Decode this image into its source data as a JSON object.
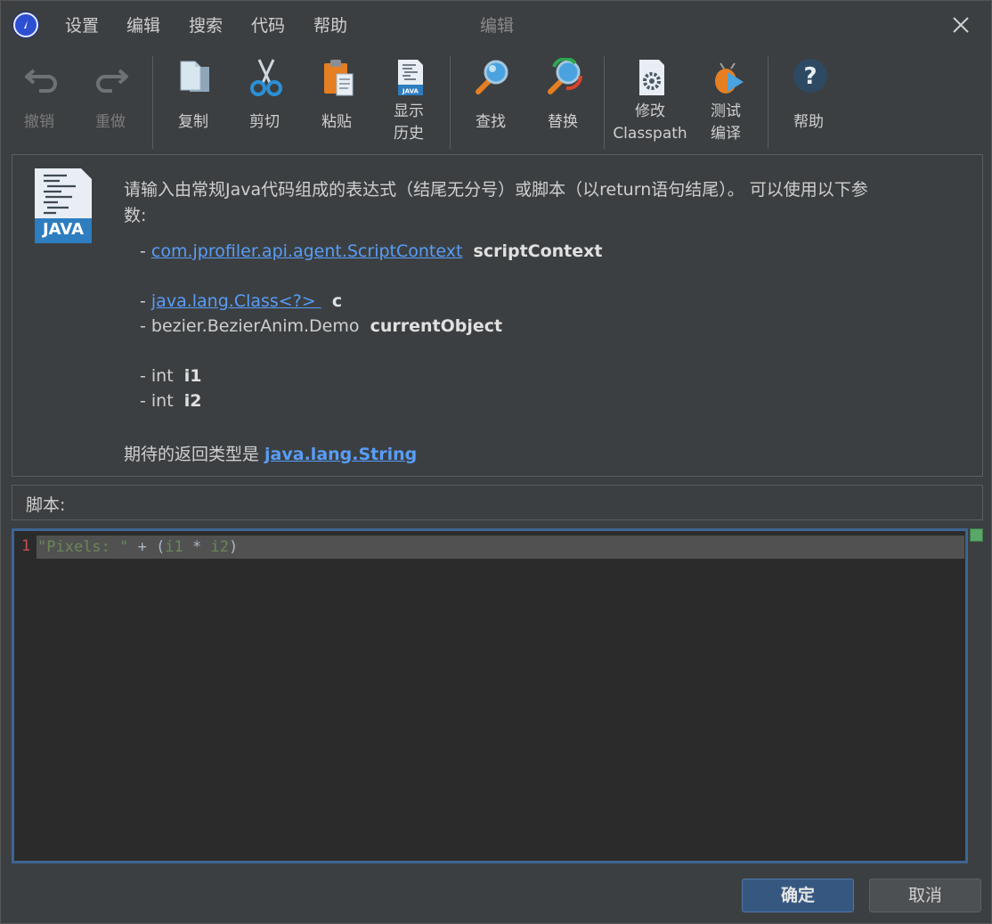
{
  "menu": {
    "items": [
      "设置",
      "编辑",
      "搜索",
      "代码",
      "帮助"
    ],
    "window_title": "编辑"
  },
  "toolbar": {
    "undo": "撤销",
    "redo": "重做",
    "copy": "复制",
    "cut": "剪切",
    "paste": "粘贴",
    "history_line1": "显示",
    "history_line2": "历史",
    "find": "查找",
    "replace": "替换",
    "classpath_line1": "修改",
    "classpath_line2": "Classpath",
    "compile_line1": "测试",
    "compile_line2": "编译",
    "help": "帮助"
  },
  "info": {
    "java_logo_text": "JAVA",
    "intro_line1": "请输入由常规Java代码组成的表达式（结尾无分号）或脚本（以return语句结尾）。 可以使用以下参",
    "intro_line2": "数:",
    "params": [
      {
        "prefix": "- ",
        "type": "com.jprofiler.api.agent.ScriptContext",
        "name": "scriptContext",
        "link": true
      },
      {
        "prefix": "- ",
        "type": "java.lang.Class<?> ",
        "name": "c",
        "link": true
      },
      {
        "prefix": "- ",
        "type": "bezier.BezierAnim.Demo",
        "name": "currentObject",
        "link": false
      },
      {
        "prefix": "- ",
        "type": "int",
        "name": "i1",
        "link": false
      },
      {
        "prefix": "- ",
        "type": "int",
        "name": "i2",
        "link": false
      }
    ],
    "return_prefix": "期待的返回类型是 ",
    "return_type": "java.lang.String"
  },
  "script": {
    "label": "脚本:",
    "line_number": "1",
    "code": {
      "string": "\"Pixels: \"",
      "plus": " + (",
      "var1": "i1",
      "times": " * ",
      "var2": "i2",
      "close": ")"
    }
  },
  "buttons": {
    "ok": "确定",
    "cancel": "取消"
  },
  "colors": {
    "background": "#3c3f41",
    "editor_bg": "#2b2b2b",
    "link": "#589df6",
    "accent": "#365880",
    "string": "#6a8759",
    "line_number": "#c84f4f"
  }
}
